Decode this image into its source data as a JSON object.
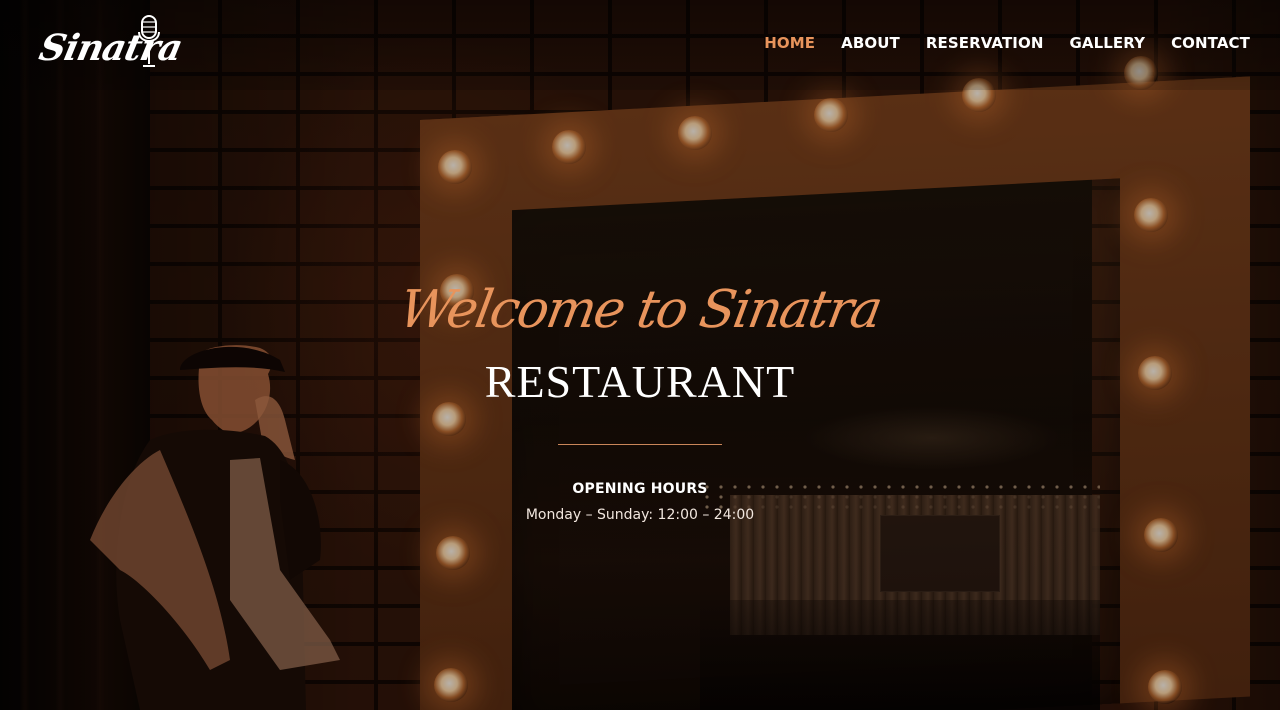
{
  "header": {
    "logo_text": "Sinatra",
    "nav": [
      {
        "label": "HOME",
        "active": true
      },
      {
        "label": "ABOUT",
        "active": false
      },
      {
        "label": "RESERVATION",
        "active": false
      },
      {
        "label": "GALLERY",
        "active": false
      },
      {
        "label": "CONTACT",
        "active": false
      }
    ]
  },
  "hero": {
    "welcome": "Welcome to Sinatra",
    "title": "RESTAURANT",
    "hours_heading": "OPENING HOURS",
    "hours_text": "Monday – Sunday: 12:00 – 24:00"
  },
  "colors": {
    "accent": "#e8945c",
    "text": "#ffffff",
    "background": "#1a0c06"
  },
  "icons": {
    "logo_mark": "microphone-icon"
  }
}
